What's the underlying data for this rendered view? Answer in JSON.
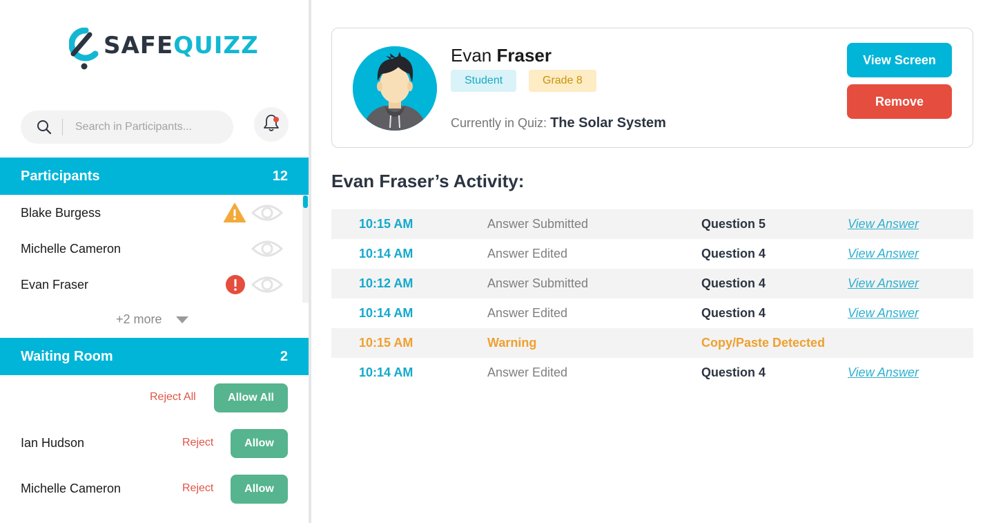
{
  "logo": {
    "part1": "SAFE",
    "part2": "QUIZZ"
  },
  "search": {
    "placeholder": "Search in Participants..."
  },
  "participants": {
    "title": "Participants",
    "count": "12",
    "items": [
      {
        "name": "Blake Burgess",
        "alert": "warning"
      },
      {
        "name": "Michelle Cameron",
        "alert": "none"
      },
      {
        "name": "Evan Fraser",
        "alert": "error"
      }
    ],
    "more": "+2 more"
  },
  "waiting": {
    "title": "Waiting Room",
    "count": "2",
    "reject_all": "Reject All",
    "allow_all": "Allow All",
    "items": [
      {
        "name": "Ian Hudson",
        "reject": "Reject",
        "allow": "Allow"
      },
      {
        "name": "Michelle Cameron",
        "reject": "Reject",
        "allow": "Allow"
      }
    ]
  },
  "profile": {
    "first_name": "Evan",
    "last_name": "Fraser",
    "role_badge": "Student",
    "grade_badge": "Grade 8",
    "quiz_label": "Currently in Quiz:",
    "quiz_name": "The Solar System",
    "view_screen": "View Screen",
    "remove": "Remove"
  },
  "activity": {
    "title": "Evan Fraser’s Activity:",
    "rows": [
      {
        "time": "10:15 AM",
        "action": "Answer Submitted",
        "target": "Question 5",
        "link": "View Answer",
        "type": "normal"
      },
      {
        "time": "10:14 AM",
        "action": "Answer Edited",
        "target": "Question 4",
        "link": "View Answer",
        "type": "normal"
      },
      {
        "time": "10:12 AM",
        "action": "Answer Submitted",
        "target": "Question 4",
        "link": "View Answer",
        "type": "normal"
      },
      {
        "time": "10:14 AM",
        "action": "Answer Edited",
        "target": "Question 4",
        "link": "View Answer",
        "type": "normal"
      },
      {
        "time": "10:15 AM",
        "action": "Warning",
        "target": "Copy/Paste Detected",
        "link": "",
        "type": "warning"
      },
      {
        "time": "10:14 AM",
        "action": "Answer Edited",
        "target": "Question 4",
        "link": "View Answer",
        "type": "normal"
      }
    ]
  },
  "colors": {
    "brand": "#00b5d8",
    "danger": "#e54d3e",
    "success": "#56b48f",
    "warning": "#efa030"
  }
}
